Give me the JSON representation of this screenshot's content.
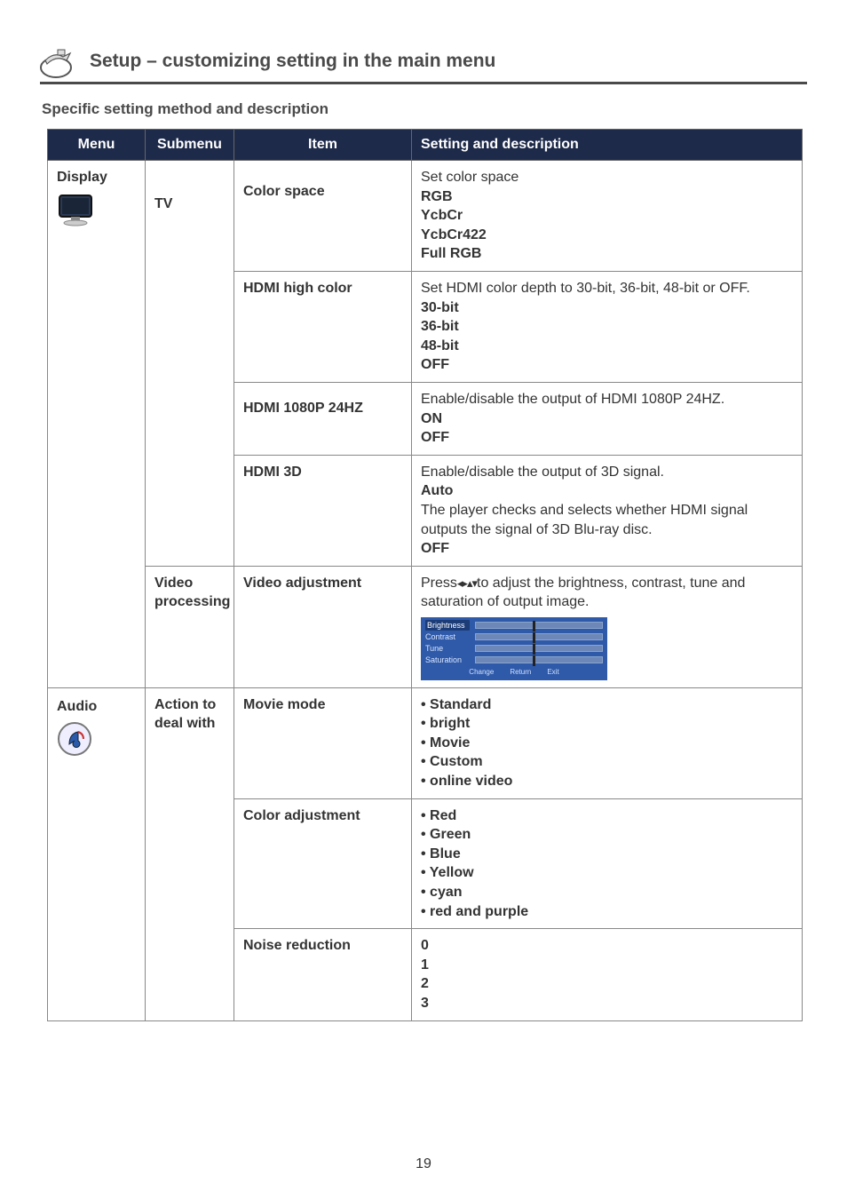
{
  "page": {
    "title": "Setup – customizing setting in the main menu",
    "subheading": "Specific setting method and description",
    "number": "19"
  },
  "table": {
    "headers": {
      "menu": "Menu",
      "submenu": "Submenu",
      "item": "Item",
      "desc": "Setting and description"
    }
  },
  "r1": {
    "menu": "Display",
    "sub": "TV",
    "item": "Color space",
    "lead": "Set color space",
    "o1": "RGB",
    "o2": "YcbCr",
    "o3": "YcbCr422",
    "o4": "Full RGB"
  },
  "r2": {
    "item": "HDMI high color",
    "lead": "Set HDMI color depth to 30-bit, 36-bit, 48-bit or OFF.",
    "o1": "30-bit",
    "o2": "36-bit",
    "o3": "48-bit",
    "o4": "OFF"
  },
  "r3": {
    "item": "HDMI 1080P 24HZ",
    "lead": "Enable/disable the output of HDMI 1080P 24HZ.",
    "o1": "ON",
    "o2": "OFF"
  },
  "r4": {
    "item": "HDMI 3D",
    "lead": "Enable/disable the output of 3D signal.",
    "o1": "Auto",
    "note": "The player checks and selects whether HDMI signal outputs the signal of 3D Blu-ray disc.",
    "o2": "OFF"
  },
  "r5": {
    "sub": "Video processing",
    "item": "Video adjustment",
    "lead1": "Press",
    "lead2": "to adjust the brightness, contrast, tune and saturation of output image.",
    "va": {
      "l1": "Brightness",
      "l2": "Contrast",
      "l3": "Tune",
      "l4": "Saturation",
      "f1": "Change",
      "f2": "Return",
      "f3": "Exit"
    }
  },
  "r6": {
    "menu": "Audio",
    "sub": "Action to deal with",
    "item": "Movie mode",
    "o1": "• Standard",
    "o2": "• bright",
    "o3": "• Movie",
    "o4": "• Custom",
    "o5": "• online video"
  },
  "r7": {
    "item": "Color adjustment",
    "o1": "• Red",
    "o2": "• Green",
    "o3": "• Blue",
    "o4": "• Yellow",
    "o5": "• cyan",
    "o6": "• red and purple"
  },
  "r8": {
    "item": "Noise reduction",
    "o1": "0",
    "o2": "1",
    "o3": "2",
    "o4": "3"
  }
}
